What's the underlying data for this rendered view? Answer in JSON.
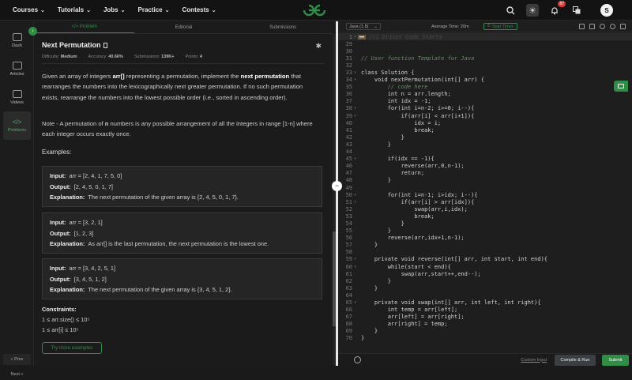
{
  "nav": {
    "items": [
      {
        "label": "Courses"
      },
      {
        "label": "Tutorials"
      },
      {
        "label": "Jobs"
      },
      {
        "label": "Practice"
      },
      {
        "label": "Contests"
      }
    ],
    "notification_count": "87",
    "avatar_letter": "S",
    "logo_text": "GfG"
  },
  "sidebar": {
    "items": [
      {
        "label": "Dash"
      },
      {
        "label": "Articles"
      },
      {
        "label": "Videos"
      },
      {
        "label": "Problems"
      }
    ],
    "prev": "« Prev",
    "next": "Next »"
  },
  "tabs": [
    "</> Problem",
    "Editorial",
    "Submissions"
  ],
  "problem": {
    "title": "Next Permutation",
    "difficulty_label": "Difficulty:",
    "difficulty": "Medium",
    "accuracy_label": "Accuracy:",
    "accuracy": "40.66%",
    "submissions_label": "Submissions:",
    "submissions": "139K+",
    "points_label": "Points:",
    "points": "4",
    "desc_parts": [
      "Given an array of integers ",
      "arr[]",
      " representing a permutation, implement the ",
      "next permutation",
      " that rearranges the numbers into the lexicographically next greater permutation. If no such permutation exists, rearrange the numbers into the lowest possible order (i.e., sorted in ascending order)."
    ],
    "note_parts": [
      "Note - A permutation of ",
      "n",
      " numbers is any possible arrangement of all the integers in range [1-n] where each integer occurs exactly once."
    ],
    "examples_heading": "Examples:",
    "input_label": "Input:",
    "output_label": "Output:",
    "explanation_label": "Explanation:",
    "examples": [
      {
        "input": "arr = [2, 4, 1, 7, 5, 0]",
        "output": "[2, 4, 5, 0, 1, 7]",
        "explanation": "The next permutation of the given array is {2, 4, 5, 0, 1, 7}."
      },
      {
        "input": "arr = [3, 2, 1]",
        "output": "[1, 2, 3]",
        "explanation": "As arr[] is the last permutation, the next permutation is the lowest one."
      },
      {
        "input": "arr = [3, 4, 2, 5, 1]",
        "output": "[3, 4, 5, 1, 2]",
        "explanation": "The next permutation of the given array is {3, 4, 5, 1, 2}."
      }
    ],
    "constraints_heading": "Constraints:",
    "constraint1": "1 ≤ arr.size() ≤ 10⁵",
    "constraint2": "1 ≤ arr[i] ≤ 10⁵",
    "try_more": "Try more examples"
  },
  "editor": {
    "language": "Java (1.8)",
    "avg_time": "Average Time: 20m",
    "start_timer": "Start Timer",
    "collapsed_marker": "▬▬",
    "lines": [
      {
        "n": "1",
        "text": "//{ Driver Code Starts",
        "sel": true
      },
      {
        "n": "29",
        "text": ""
      },
      {
        "n": "30",
        "text": ""
      },
      {
        "n": "31",
        "text": "// User function Template for Java"
      },
      {
        "n": "32",
        "text": ""
      },
      {
        "n": "33",
        "text": "class Solution {"
      },
      {
        "n": "34",
        "text": "    void nextPermutation(int[] arr) {"
      },
      {
        "n": "35",
        "text": "        // code here"
      },
      {
        "n": "36",
        "text": "        int n = arr.length;"
      },
      {
        "n": "37",
        "text": "        int idx = -1;"
      },
      {
        "n": "38",
        "text": "        for(int i=n-2; i>=0; i--){"
      },
      {
        "n": "39",
        "text": "            if(arr[i] < arr[i+1]){"
      },
      {
        "n": "40",
        "text": "                idx = i;"
      },
      {
        "n": "41",
        "text": "                break;"
      },
      {
        "n": "42",
        "text": "            }"
      },
      {
        "n": "43",
        "text": "        }"
      },
      {
        "n": "44",
        "text": ""
      },
      {
        "n": "45",
        "text": "        if(idx == -1){"
      },
      {
        "n": "46",
        "text": "            reverse(arr,0,n-1);"
      },
      {
        "n": "47",
        "text": "            return;"
      },
      {
        "n": "48",
        "text": "        }"
      },
      {
        "n": "49",
        "text": ""
      },
      {
        "n": "50",
        "text": "        for(int i=n-1; i>idx; i--){"
      },
      {
        "n": "51",
        "text": "            if(arr[i] > arr[idx]){"
      },
      {
        "n": "52",
        "text": "                swap(arr,i,idx);"
      },
      {
        "n": "53",
        "text": "                break;"
      },
      {
        "n": "54",
        "text": "            }"
      },
      {
        "n": "55",
        "text": "        }"
      },
      {
        "n": "56",
        "text": "        reverse(arr,idx+1,n-1);"
      },
      {
        "n": "57",
        "text": "    }"
      },
      {
        "n": "58",
        "text": ""
      },
      {
        "n": "59",
        "text": "    private void reverse(int[] arr, int start, int end){"
      },
      {
        "n": "60",
        "text": "        while(start < end){"
      },
      {
        "n": "61",
        "text": "            swap(arr,start++,end--);"
      },
      {
        "n": "62",
        "text": "        }"
      },
      {
        "n": "63",
        "text": "    }"
      },
      {
        "n": "64",
        "text": ""
      },
      {
        "n": "65",
        "text": "    private void swap(int[] arr, int left, int right){"
      },
      {
        "n": "66",
        "text": "        int temp = arr[left];"
      },
      {
        "n": "67",
        "text": "        arr[left] = arr[right];"
      },
      {
        "n": "68",
        "text": "        arr[right] = temp;"
      },
      {
        "n": "69",
        "text": "    }"
      },
      {
        "n": "70",
        "text": "}"
      }
    ],
    "custom_input": "Custom Input",
    "compile_run": "Compile & Run",
    "submit": "Submit"
  },
  "colors": {
    "accent": "#2f8d46",
    "badge": "#d23b3b"
  }
}
